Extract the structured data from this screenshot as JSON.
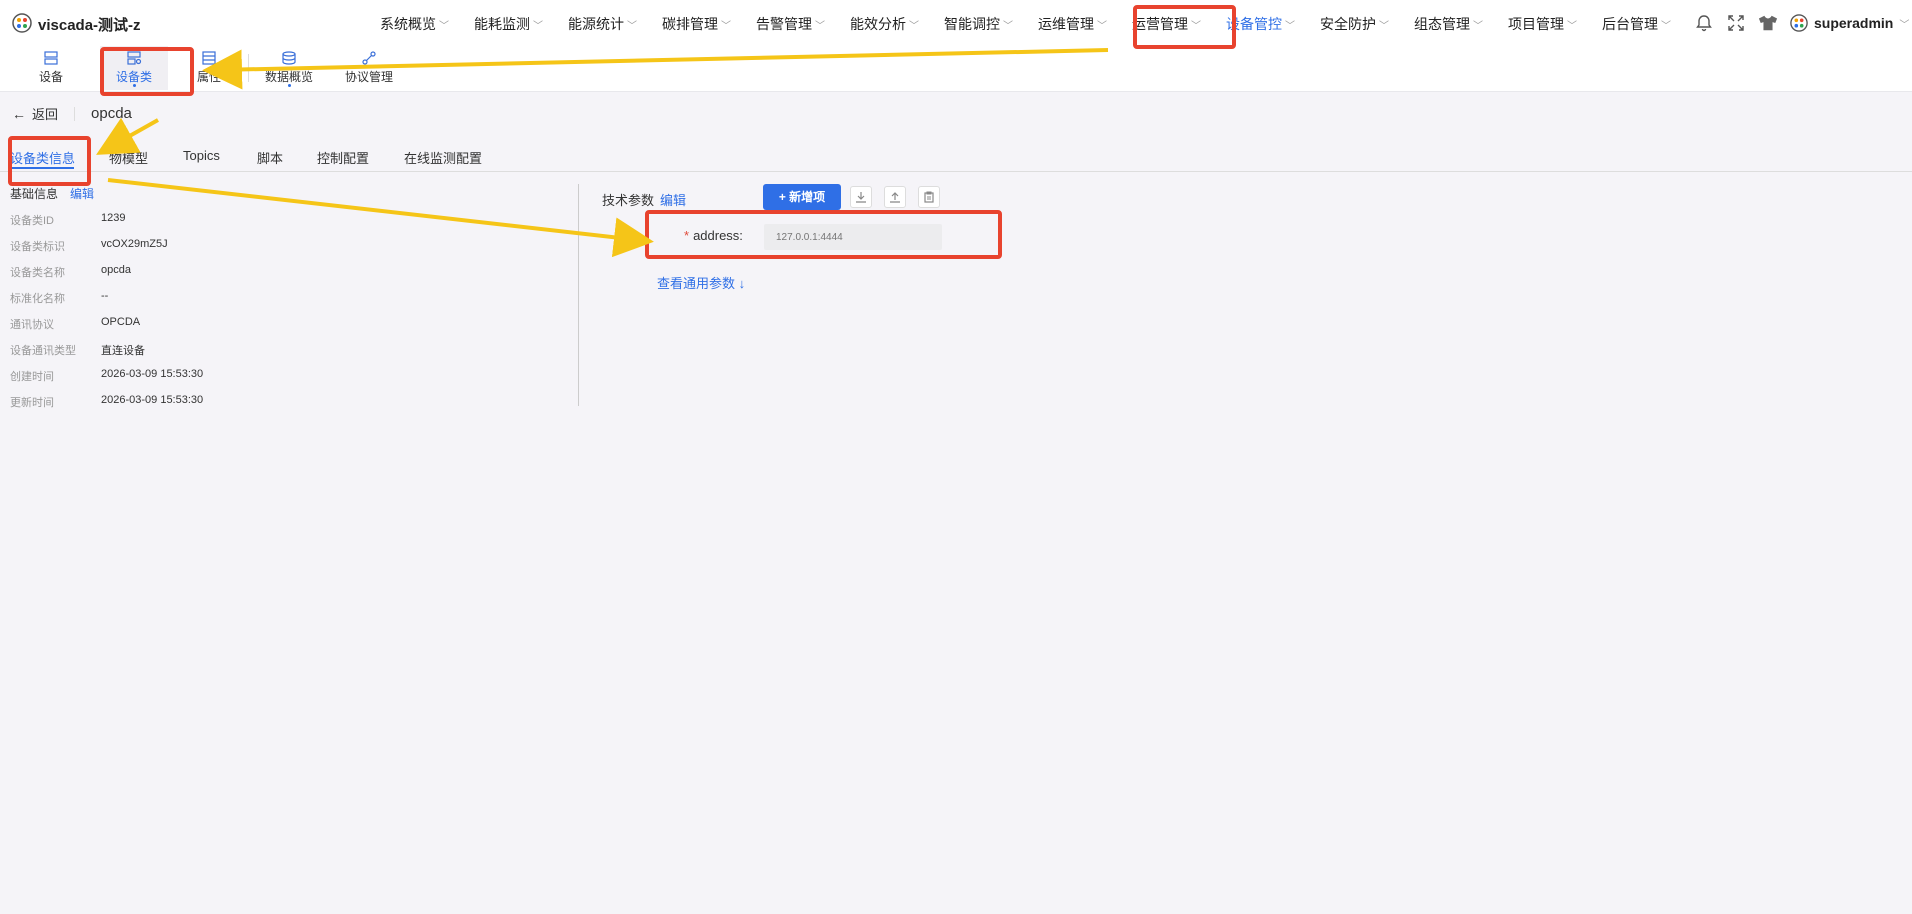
{
  "app": {
    "title": "viscada-测试-z"
  },
  "mainnav": [
    {
      "label": "系统概览"
    },
    {
      "label": "能耗监测"
    },
    {
      "label": "能源统计"
    },
    {
      "label": "碳排管理"
    },
    {
      "label": "告警管理"
    },
    {
      "label": "能效分析"
    },
    {
      "label": "智能调控"
    },
    {
      "label": "运维管理"
    },
    {
      "label": "运营管理"
    },
    {
      "label": "设备管控",
      "active": true
    },
    {
      "label": "安全防护"
    },
    {
      "label": "组态管理"
    },
    {
      "label": "项目管理"
    },
    {
      "label": "后台管理"
    }
  ],
  "user": {
    "name": "superadmin"
  },
  "toolbar": {
    "device": "设备",
    "device_class": "设备类",
    "property": "属性",
    "data_overview": "数据概览",
    "protocol": "协议管理"
  },
  "back": {
    "label": "返回",
    "name": "opcda"
  },
  "tabs": {
    "info": "设备类信息",
    "model": "物模型",
    "topics": "Topics",
    "script": "脚本",
    "control": "控制配置",
    "monitor": "在线监测配置"
  },
  "basic": {
    "title": "基础信息",
    "edit": "编辑",
    "rows": [
      {
        "label": "设备类ID",
        "value": "1239"
      },
      {
        "label": "设备类标识",
        "value": "vcOX29mZ5J"
      },
      {
        "label": "设备类名称",
        "value": "opcda"
      },
      {
        "label": "标准化名称",
        "value": "--"
      },
      {
        "label": "通讯协议",
        "value": "OPCDA"
      },
      {
        "label": "设备通讯类型",
        "value": "直连设备"
      },
      {
        "label": "创建时间",
        "value": "2026-03-09 15:53:30"
      },
      {
        "label": "更新时间",
        "value": "2026-03-09 15:53:30"
      }
    ]
  },
  "tech": {
    "title": "技术参数",
    "edit": "编辑",
    "add_button": "+ 新增项",
    "field_label": "address:",
    "field_value": "127.0.0.1:4444",
    "view_link": "查看通用参数 ↓"
  },
  "colors": {
    "accent": "#2f6fe6",
    "annotation": "#e8432e",
    "arrow": "#f5c518"
  },
  "icons": [
    "bell-icon",
    "fullscreen-icon",
    "shirt-icon",
    "avatar-icon",
    "download-icon",
    "upload-icon",
    "clipboard-icon"
  ]
}
